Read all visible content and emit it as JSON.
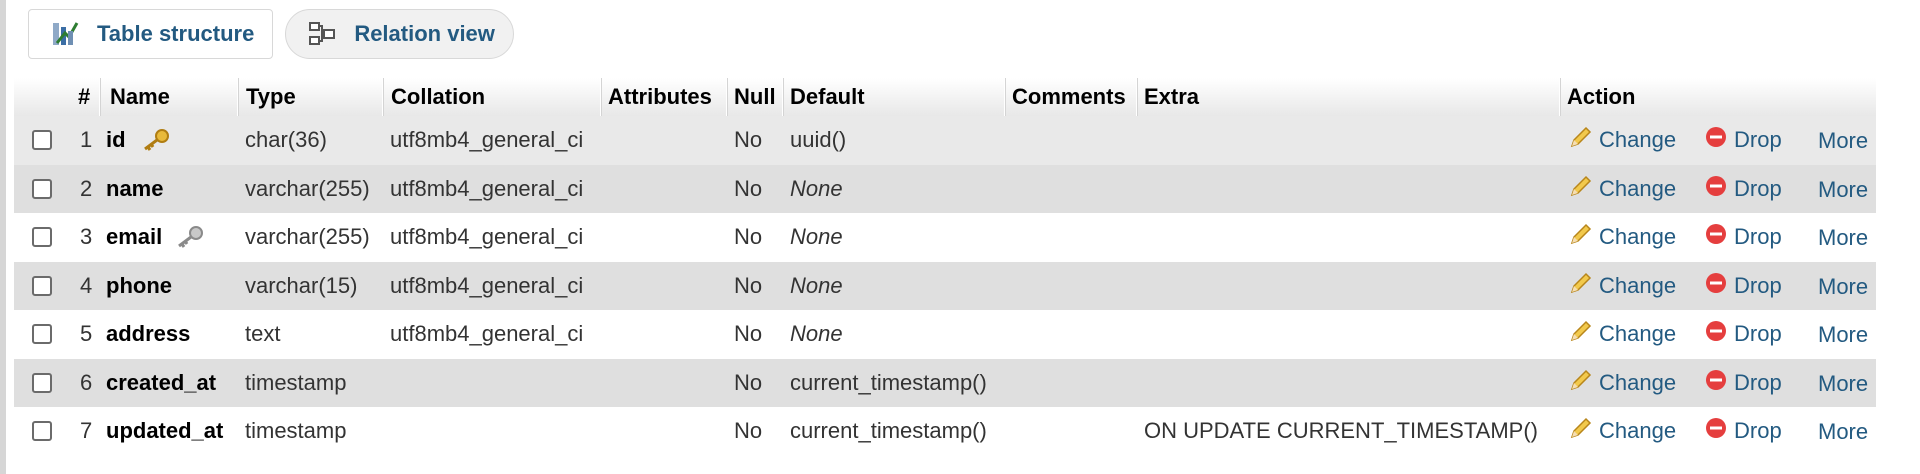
{
  "tabs": [
    {
      "label": "Table structure",
      "icon": "table-structure-icon",
      "active": true
    },
    {
      "label": "Relation view",
      "icon": "relation-view-icon",
      "active": false
    }
  ],
  "columns": [
    "#",
    "Name",
    "Type",
    "Collation",
    "Attributes",
    "Null",
    "Default",
    "Comments",
    "Extra",
    "Action"
  ],
  "actions": {
    "change": "Change",
    "drop": "Drop",
    "more": "More"
  },
  "rows": [
    {
      "num": "1",
      "name": "id",
      "key": "primary",
      "type": "char(36)",
      "collation": "utf8mb4_general_ci",
      "attributes": "",
      "null": "No",
      "default": "uuid()",
      "default_italic": false,
      "comments": "",
      "extra": ""
    },
    {
      "num": "2",
      "name": "name",
      "key": "",
      "type": "varchar(255)",
      "collation": "utf8mb4_general_ci",
      "attributes": "",
      "null": "No",
      "default": "None",
      "default_italic": true,
      "comments": "",
      "extra": ""
    },
    {
      "num": "3",
      "name": "email",
      "key": "unique",
      "type": "varchar(255)",
      "collation": "utf8mb4_general_ci",
      "attributes": "",
      "null": "No",
      "default": "None",
      "default_italic": true,
      "comments": "",
      "extra": ""
    },
    {
      "num": "4",
      "name": "phone",
      "key": "",
      "type": "varchar(15)",
      "collation": "utf8mb4_general_ci",
      "attributes": "",
      "null": "No",
      "default": "None",
      "default_italic": true,
      "comments": "",
      "extra": ""
    },
    {
      "num": "5",
      "name": "address",
      "key": "",
      "type": "text",
      "collation": "utf8mb4_general_ci",
      "attributes": "",
      "null": "No",
      "default": "None",
      "default_italic": true,
      "comments": "",
      "extra": ""
    },
    {
      "num": "6",
      "name": "created_at",
      "key": "",
      "type": "timestamp",
      "collation": "",
      "attributes": "",
      "null": "No",
      "default": "current_timestamp()",
      "default_italic": false,
      "comments": "",
      "extra": ""
    },
    {
      "num": "7",
      "name": "updated_at",
      "key": "",
      "type": "timestamp",
      "collation": "",
      "attributes": "",
      "null": "No",
      "default": "current_timestamp()",
      "default_italic": false,
      "comments": "",
      "extra": "ON UPDATE CURRENT_TIMESTAMP()"
    }
  ],
  "colors": {
    "link": "#235a81",
    "drop_icon": "#e53e3e",
    "key_primary": "#e8b93a",
    "key_unique": "#a0a0a0"
  }
}
